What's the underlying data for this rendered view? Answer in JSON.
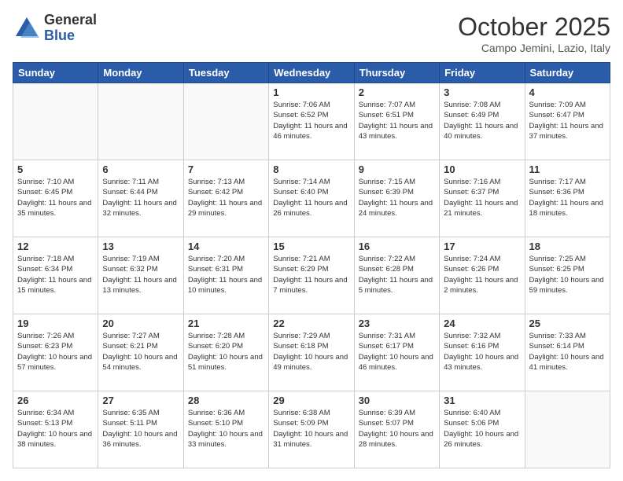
{
  "header": {
    "logo_general": "General",
    "logo_blue": "Blue",
    "month_title": "October 2025",
    "location": "Campo Jemini, Lazio, Italy"
  },
  "days_of_week": [
    "Sunday",
    "Monday",
    "Tuesday",
    "Wednesday",
    "Thursday",
    "Friday",
    "Saturday"
  ],
  "weeks": [
    [
      {
        "day": "",
        "info": ""
      },
      {
        "day": "",
        "info": ""
      },
      {
        "day": "",
        "info": ""
      },
      {
        "day": "1",
        "info": "Sunrise: 7:06 AM\nSunset: 6:52 PM\nDaylight: 11 hours\nand 46 minutes."
      },
      {
        "day": "2",
        "info": "Sunrise: 7:07 AM\nSunset: 6:51 PM\nDaylight: 11 hours\nand 43 minutes."
      },
      {
        "day": "3",
        "info": "Sunrise: 7:08 AM\nSunset: 6:49 PM\nDaylight: 11 hours\nand 40 minutes."
      },
      {
        "day": "4",
        "info": "Sunrise: 7:09 AM\nSunset: 6:47 PM\nDaylight: 11 hours\nand 37 minutes."
      }
    ],
    [
      {
        "day": "5",
        "info": "Sunrise: 7:10 AM\nSunset: 6:45 PM\nDaylight: 11 hours\nand 35 minutes."
      },
      {
        "day": "6",
        "info": "Sunrise: 7:11 AM\nSunset: 6:44 PM\nDaylight: 11 hours\nand 32 minutes."
      },
      {
        "day": "7",
        "info": "Sunrise: 7:13 AM\nSunset: 6:42 PM\nDaylight: 11 hours\nand 29 minutes."
      },
      {
        "day": "8",
        "info": "Sunrise: 7:14 AM\nSunset: 6:40 PM\nDaylight: 11 hours\nand 26 minutes."
      },
      {
        "day": "9",
        "info": "Sunrise: 7:15 AM\nSunset: 6:39 PM\nDaylight: 11 hours\nand 24 minutes."
      },
      {
        "day": "10",
        "info": "Sunrise: 7:16 AM\nSunset: 6:37 PM\nDaylight: 11 hours\nand 21 minutes."
      },
      {
        "day": "11",
        "info": "Sunrise: 7:17 AM\nSunset: 6:36 PM\nDaylight: 11 hours\nand 18 minutes."
      }
    ],
    [
      {
        "day": "12",
        "info": "Sunrise: 7:18 AM\nSunset: 6:34 PM\nDaylight: 11 hours\nand 15 minutes."
      },
      {
        "day": "13",
        "info": "Sunrise: 7:19 AM\nSunset: 6:32 PM\nDaylight: 11 hours\nand 13 minutes."
      },
      {
        "day": "14",
        "info": "Sunrise: 7:20 AM\nSunset: 6:31 PM\nDaylight: 11 hours\nand 10 minutes."
      },
      {
        "day": "15",
        "info": "Sunrise: 7:21 AM\nSunset: 6:29 PM\nDaylight: 11 hours\nand 7 minutes."
      },
      {
        "day": "16",
        "info": "Sunrise: 7:22 AM\nSunset: 6:28 PM\nDaylight: 11 hours\nand 5 minutes."
      },
      {
        "day": "17",
        "info": "Sunrise: 7:24 AM\nSunset: 6:26 PM\nDaylight: 11 hours\nand 2 minutes."
      },
      {
        "day": "18",
        "info": "Sunrise: 7:25 AM\nSunset: 6:25 PM\nDaylight: 10 hours\nand 59 minutes."
      }
    ],
    [
      {
        "day": "19",
        "info": "Sunrise: 7:26 AM\nSunset: 6:23 PM\nDaylight: 10 hours\nand 57 minutes."
      },
      {
        "day": "20",
        "info": "Sunrise: 7:27 AM\nSunset: 6:21 PM\nDaylight: 10 hours\nand 54 minutes."
      },
      {
        "day": "21",
        "info": "Sunrise: 7:28 AM\nSunset: 6:20 PM\nDaylight: 10 hours\nand 51 minutes."
      },
      {
        "day": "22",
        "info": "Sunrise: 7:29 AM\nSunset: 6:18 PM\nDaylight: 10 hours\nand 49 minutes."
      },
      {
        "day": "23",
        "info": "Sunrise: 7:31 AM\nSunset: 6:17 PM\nDaylight: 10 hours\nand 46 minutes."
      },
      {
        "day": "24",
        "info": "Sunrise: 7:32 AM\nSunset: 6:16 PM\nDaylight: 10 hours\nand 43 minutes."
      },
      {
        "day": "25",
        "info": "Sunrise: 7:33 AM\nSunset: 6:14 PM\nDaylight: 10 hours\nand 41 minutes."
      }
    ],
    [
      {
        "day": "26",
        "info": "Sunrise: 6:34 AM\nSunset: 5:13 PM\nDaylight: 10 hours\nand 38 minutes."
      },
      {
        "day": "27",
        "info": "Sunrise: 6:35 AM\nSunset: 5:11 PM\nDaylight: 10 hours\nand 36 minutes."
      },
      {
        "day": "28",
        "info": "Sunrise: 6:36 AM\nSunset: 5:10 PM\nDaylight: 10 hours\nand 33 minutes."
      },
      {
        "day": "29",
        "info": "Sunrise: 6:38 AM\nSunset: 5:09 PM\nDaylight: 10 hours\nand 31 minutes."
      },
      {
        "day": "30",
        "info": "Sunrise: 6:39 AM\nSunset: 5:07 PM\nDaylight: 10 hours\nand 28 minutes."
      },
      {
        "day": "31",
        "info": "Sunrise: 6:40 AM\nSunset: 5:06 PM\nDaylight: 10 hours\nand 26 minutes."
      },
      {
        "day": "",
        "info": ""
      }
    ]
  ]
}
